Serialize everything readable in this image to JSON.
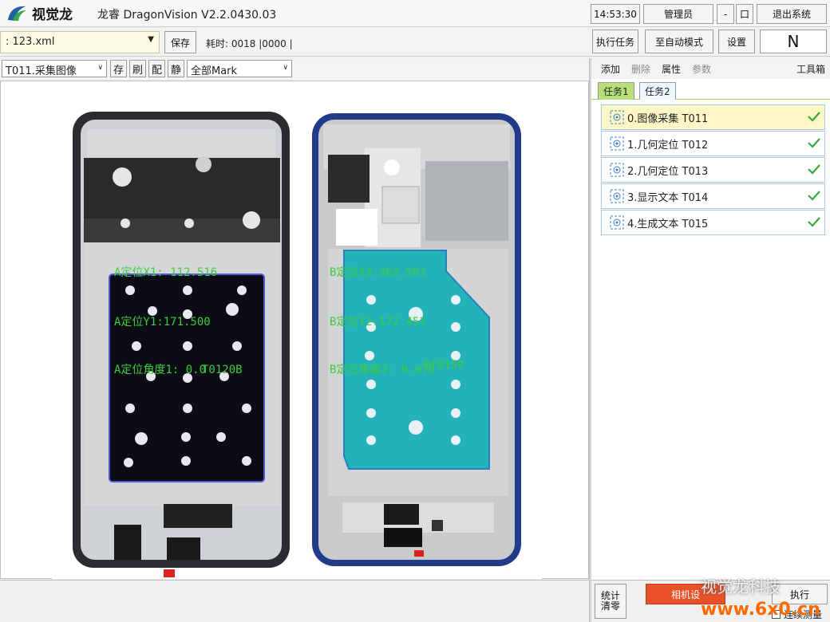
{
  "app": {
    "logo_text": "视觉龙",
    "title": "龙睿 DragonVision V2.2.0430.03",
    "clock": "14:53:30",
    "user": "管理员",
    "minimize": "-",
    "maximize": "口",
    "exit": "退出系统"
  },
  "toolbar": {
    "file_value": ": 123.xml",
    "save": "保存",
    "status": "耗时: 0018 |0000  |",
    "run_task": "执行任务",
    "auto_mode": "至自动模式",
    "settings": "设置",
    "indicator": "N"
  },
  "image_toolbar": {
    "task_combo": "T011.采集图像",
    "btn_save": "存",
    "btn_refresh": "刷",
    "btn_config": "配",
    "btn_static": "静",
    "mark_combo": "全部Mark"
  },
  "overlay": {
    "a_x": "A定位X1: 112.516",
    "a_y": "A定位Y1:171.500",
    "a_angle": "A定位角度1: 0.0",
    "a_code": "T0120B",
    "b_x": "B定位X2:302.503",
    "b_y": "B定位Y2:172.451",
    "b_angle": "B定位角度2: 0.075",
    "b_code": "0T0150"
  },
  "right_panel": {
    "actions": [
      "添加",
      "删除",
      "属性",
      "参数"
    ],
    "toolbox": "工具箱",
    "tabs": [
      "任务1",
      "任务2"
    ],
    "tasks": [
      {
        "label": "0.图像采集 T011",
        "selected": true
      },
      {
        "label": "1.几何定位 T012",
        "selected": false
      },
      {
        "label": "2.几何定位 T013",
        "selected": false
      },
      {
        "label": "3.显示文本 T014",
        "selected": false
      },
      {
        "label": "4.生成文本 T015",
        "selected": false
      }
    ]
  },
  "bottom": {
    "stats_clear": "统计\n清零",
    "camera_btn": "相机设",
    "run_btn": "执行",
    "continuous": "连续测量",
    "watermark": "视觉龙科技",
    "site": "www.6x0.cn"
  },
  "colors": {
    "accent_green": "#3ecb3e",
    "selected_row": "#fdf7c8",
    "tab_active": "#b7e07a",
    "check_green": "#3aa83a"
  }
}
